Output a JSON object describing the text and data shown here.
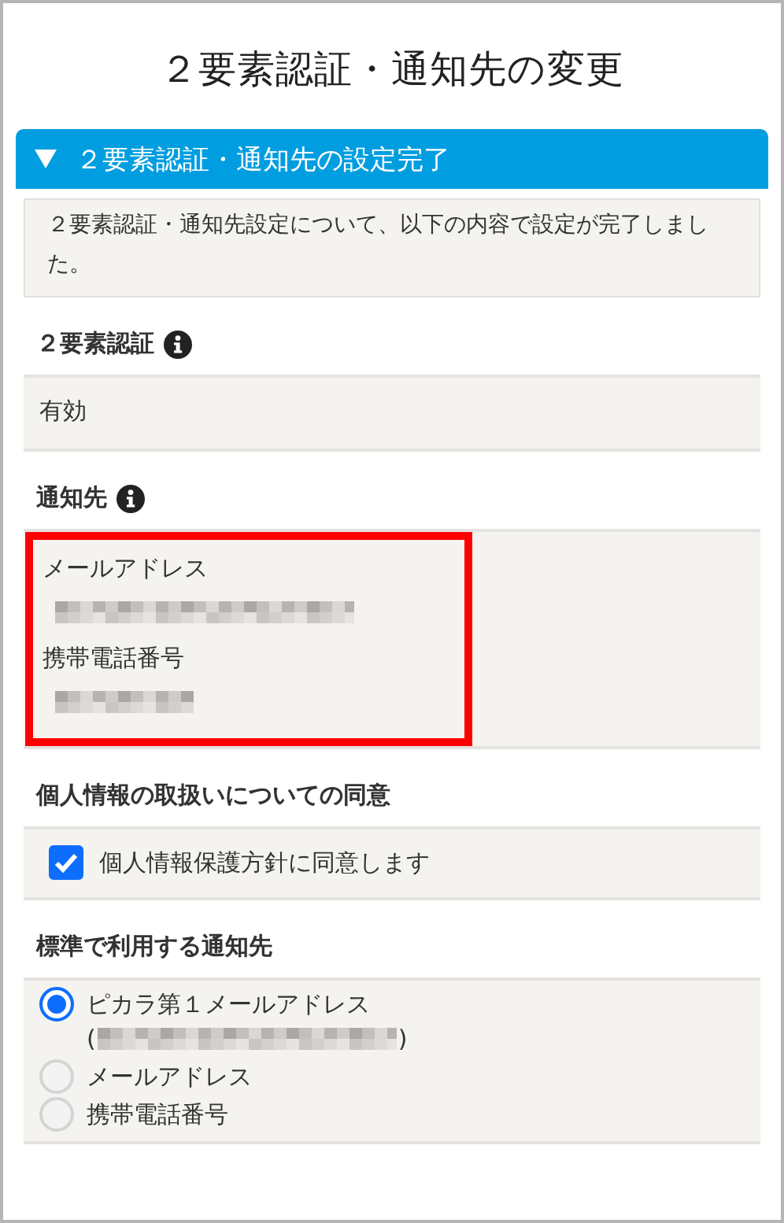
{
  "title": "２要素認証・通知先の変更",
  "panel": {
    "header": "２要素認証・通知先の設定完了",
    "expanded": true,
    "message": "２要素認証・通知先設定について、以下の内容で設定が完了しました。"
  },
  "sections": [
    {
      "kind": "value",
      "label": "２要素認証",
      "info": true,
      "value": "有効"
    },
    {
      "kind": "contacts",
      "label": "通知先",
      "info": true,
      "highlighted": true,
      "items": [
        {
          "label": "メールアドレス",
          "kind": "email",
          "redacted": true
        },
        {
          "label": "携帯電話番号",
          "kind": "phone",
          "redacted": true
        }
      ]
    },
    {
      "kind": "checkbox",
      "label": "個人情報の取扱いについての同意",
      "info": false,
      "checkbox": {
        "label": "個人情報保護方針に同意します",
        "checked": true
      }
    },
    {
      "kind": "radio",
      "label": "標準で利用する通知先",
      "info": false,
      "options": [
        {
          "label": "ピカラ第１メールアドレス",
          "open_paren": "(",
          "close_paren": ")",
          "kind": "email",
          "redacted": true,
          "selected": true
        },
        {
          "label": "メールアドレス",
          "selected": false
        },
        {
          "label": "携帯電話番号",
          "selected": false
        }
      ]
    }
  ]
}
